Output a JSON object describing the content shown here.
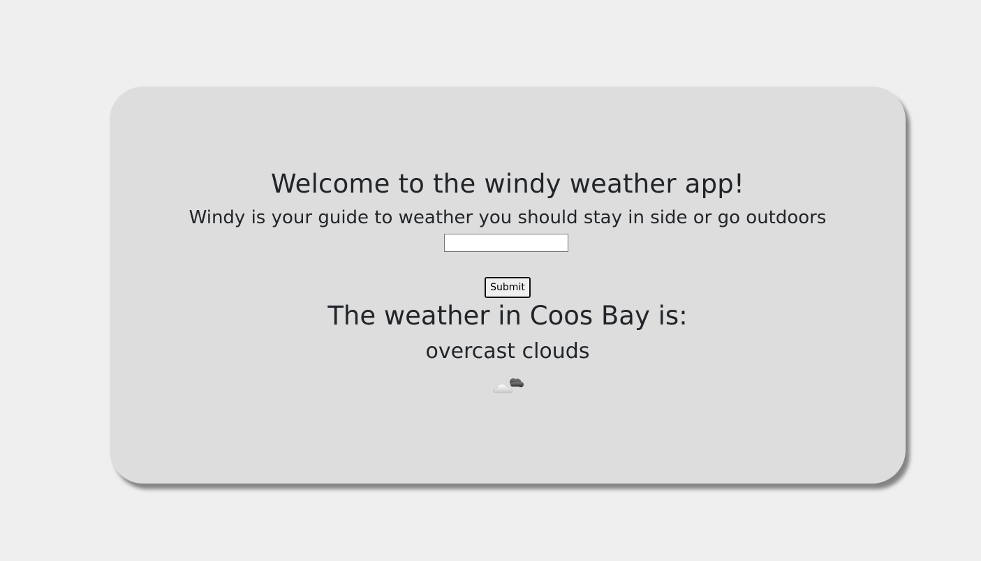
{
  "app": {
    "title": "Welcome to the windy weather app!",
    "subtitle": "Windy is your guide to weather you should stay in side or go outdoors"
  },
  "search": {
    "value": "",
    "placeholder": "",
    "submit_label": "Submit"
  },
  "result": {
    "heading": "The weather in Coos Bay is:",
    "description": "overcast clouds",
    "icon": "overcast-clouds-icon"
  },
  "colors": {
    "page_background": "#efefef",
    "card_background": "#dddddd",
    "text": "#212529"
  }
}
